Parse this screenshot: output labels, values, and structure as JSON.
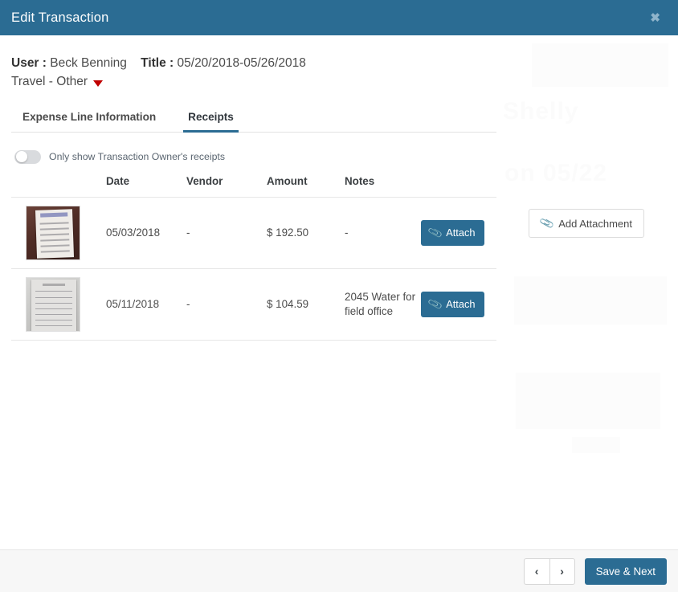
{
  "header": {
    "title": "Edit Transaction",
    "close_icon": "close-icon",
    "close_glyph": "✖",
    "bg_color": "#2b6c93"
  },
  "meta": {
    "user_label": "User :",
    "user_value": "Beck Benning",
    "title_label": "Title :",
    "title_value": "05/20/2018-05/26/2018",
    "category": "Travel - Other",
    "caret_icon": "caret-down-icon",
    "caret_color": "#c00000"
  },
  "tabs": [
    {
      "label": "Expense Line Information",
      "active": false
    },
    {
      "label": "Receipts",
      "active": true
    }
  ],
  "toggle": {
    "label": "Only show Transaction Owner's receipts",
    "checked": false
  },
  "table": {
    "columns": [
      "",
      "Date",
      "Vendor",
      "Amount",
      "Notes",
      ""
    ],
    "rows": [
      {
        "thumbnail": "receipt-thumbnail-guest-check",
        "date": "05/03/2018",
        "vendor": "-",
        "amount": "$ 192.50",
        "notes": "-",
        "action_label": "Attach",
        "action_icon": "paperclip-icon"
      },
      {
        "thumbnail": "receipt-thumbnail-invoice",
        "date": "05/11/2018",
        "vendor": "-",
        "amount": "$ 104.59",
        "notes": "2045 Water for field office",
        "action_label": "Attach",
        "action_icon": "paperclip-icon"
      }
    ]
  },
  "right_panel": {
    "add_attachment_label": "Add Attachment",
    "add_attachment_icon": "paperclip-icon"
  },
  "footer": {
    "prev_label": "‹",
    "next_label": "›",
    "prev_icon": "chevron-left-icon",
    "next_icon": "chevron-right-icon",
    "save_label": "Save & Next",
    "save_color": "#2b6c93"
  }
}
